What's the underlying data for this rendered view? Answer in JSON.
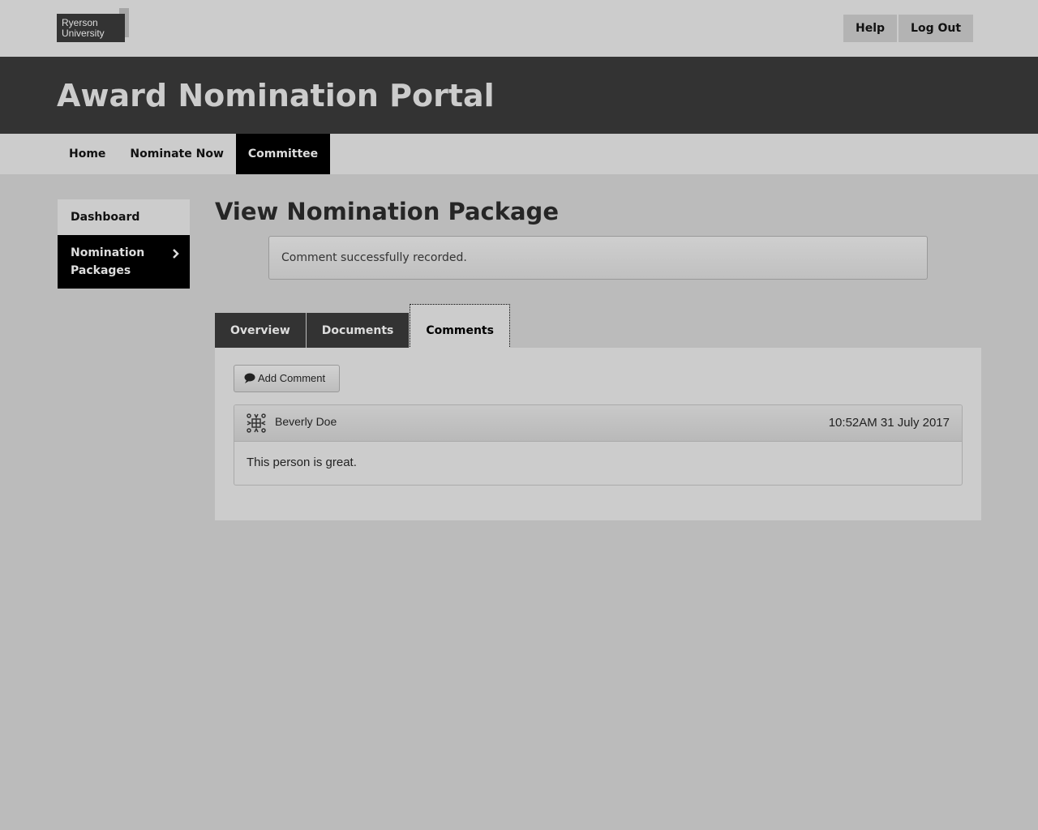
{
  "logo": {
    "line1": "Ryerson",
    "line2": "University"
  },
  "top_buttons": {
    "help": "Help",
    "logout": "Log Out"
  },
  "banner_title": "Award Nomination Portal",
  "nav": {
    "home": "Home",
    "nominate": "Nominate Now",
    "committee": "Committee"
  },
  "sidebar": {
    "dashboard": "Dashboard",
    "packages": "Nomination Packages"
  },
  "page_title": "View Nomination Package",
  "alert": "Comment successfully recorded.",
  "tabs": {
    "overview": "Overview",
    "documents": "Documents",
    "comments": "Comments"
  },
  "add_comment": "Add Comment",
  "comment": {
    "author": "Beverly Doe",
    "time": "10:52AM 31 July 2017",
    "body": "This person is great."
  }
}
